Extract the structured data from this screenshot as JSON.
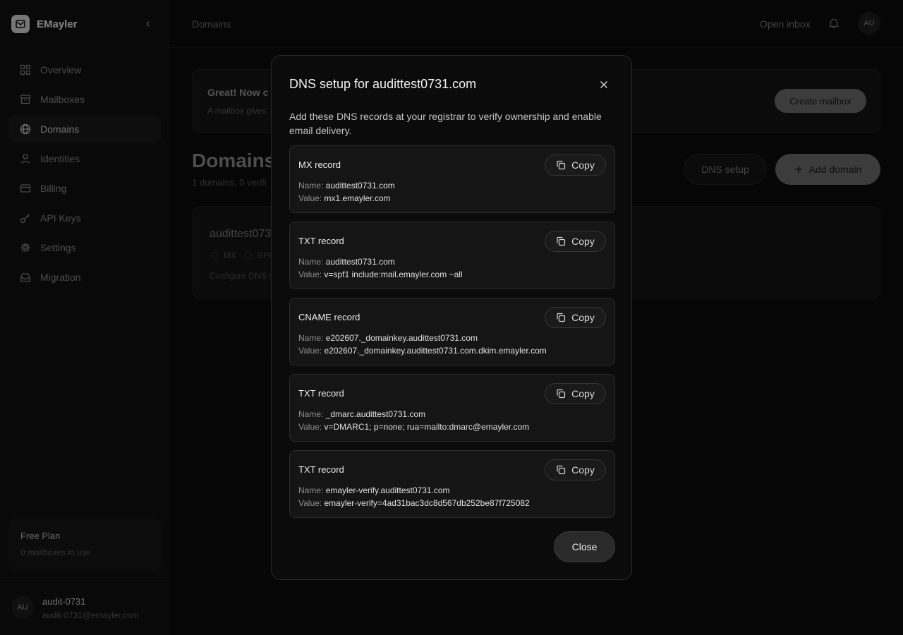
{
  "app": {
    "name": "EMayler"
  },
  "sidebar": {
    "items": [
      {
        "label": "Overview",
        "icon": "grid-icon"
      },
      {
        "label": "Mailboxes",
        "icon": "archive-icon"
      },
      {
        "label": "Domains",
        "icon": "globe-icon",
        "active": true
      },
      {
        "label": "Identities",
        "icon": "user-icon"
      },
      {
        "label": "Billing",
        "icon": "credit-card-icon"
      },
      {
        "label": "API Keys",
        "icon": "key-icon"
      },
      {
        "label": "Settings",
        "icon": "gear-icon"
      },
      {
        "label": "Migration",
        "icon": "inbox-icon"
      }
    ],
    "plan": {
      "title": "Free Plan",
      "subtitle": "0 mailboxes in use"
    },
    "user": {
      "initials": "AU",
      "name": "audit-0731",
      "email": "audit-0731@emayler.com"
    }
  },
  "header": {
    "breadcrumb": "Domains",
    "open_inbox": "Open inbox",
    "avatar_initials": "AU"
  },
  "main": {
    "banner": {
      "title": "Great! Now c",
      "subtitle": "A mailbox gives",
      "button": "Create mailbox"
    },
    "title": "Domains",
    "subtitle": "1 domains, 0 verifi",
    "dns_setup_button": "DNS setup",
    "add_domain_button": "Add domain",
    "domain_card": {
      "name": "audittest073",
      "chips": [
        "MX",
        "SPF"
      ],
      "hint": "Configure DNS r"
    }
  },
  "modal": {
    "title": "DNS setup for audittest0731.com",
    "description": "Add these DNS records at your registrar to verify ownership and enable email delivery.",
    "name_label": "Name:",
    "value_label": "Value:",
    "copy_label": "Copy",
    "close_button": "Close",
    "records": [
      {
        "type": "MX record",
        "name": "audittest0731.com",
        "value": "mx1.emayler.com"
      },
      {
        "type": "TXT record",
        "name": "audittest0731.com",
        "value": "v=spf1 include:mail.emayler.com ~all"
      },
      {
        "type": "CNAME record",
        "name": "e202607._domainkey.audittest0731.com",
        "value": "e202607._domainkey.audittest0731.com.dkim.emayler.com"
      },
      {
        "type": "TXT record",
        "name": "_dmarc.audittest0731.com",
        "value": "v=DMARC1; p=none; rua=mailto:dmarc@emayler.com"
      },
      {
        "type": "TXT record",
        "name": "emayler-verify.audittest0731.com",
        "value": "emayler-verify=4ad31bac3dc8d567db252be87f725082"
      }
    ]
  }
}
